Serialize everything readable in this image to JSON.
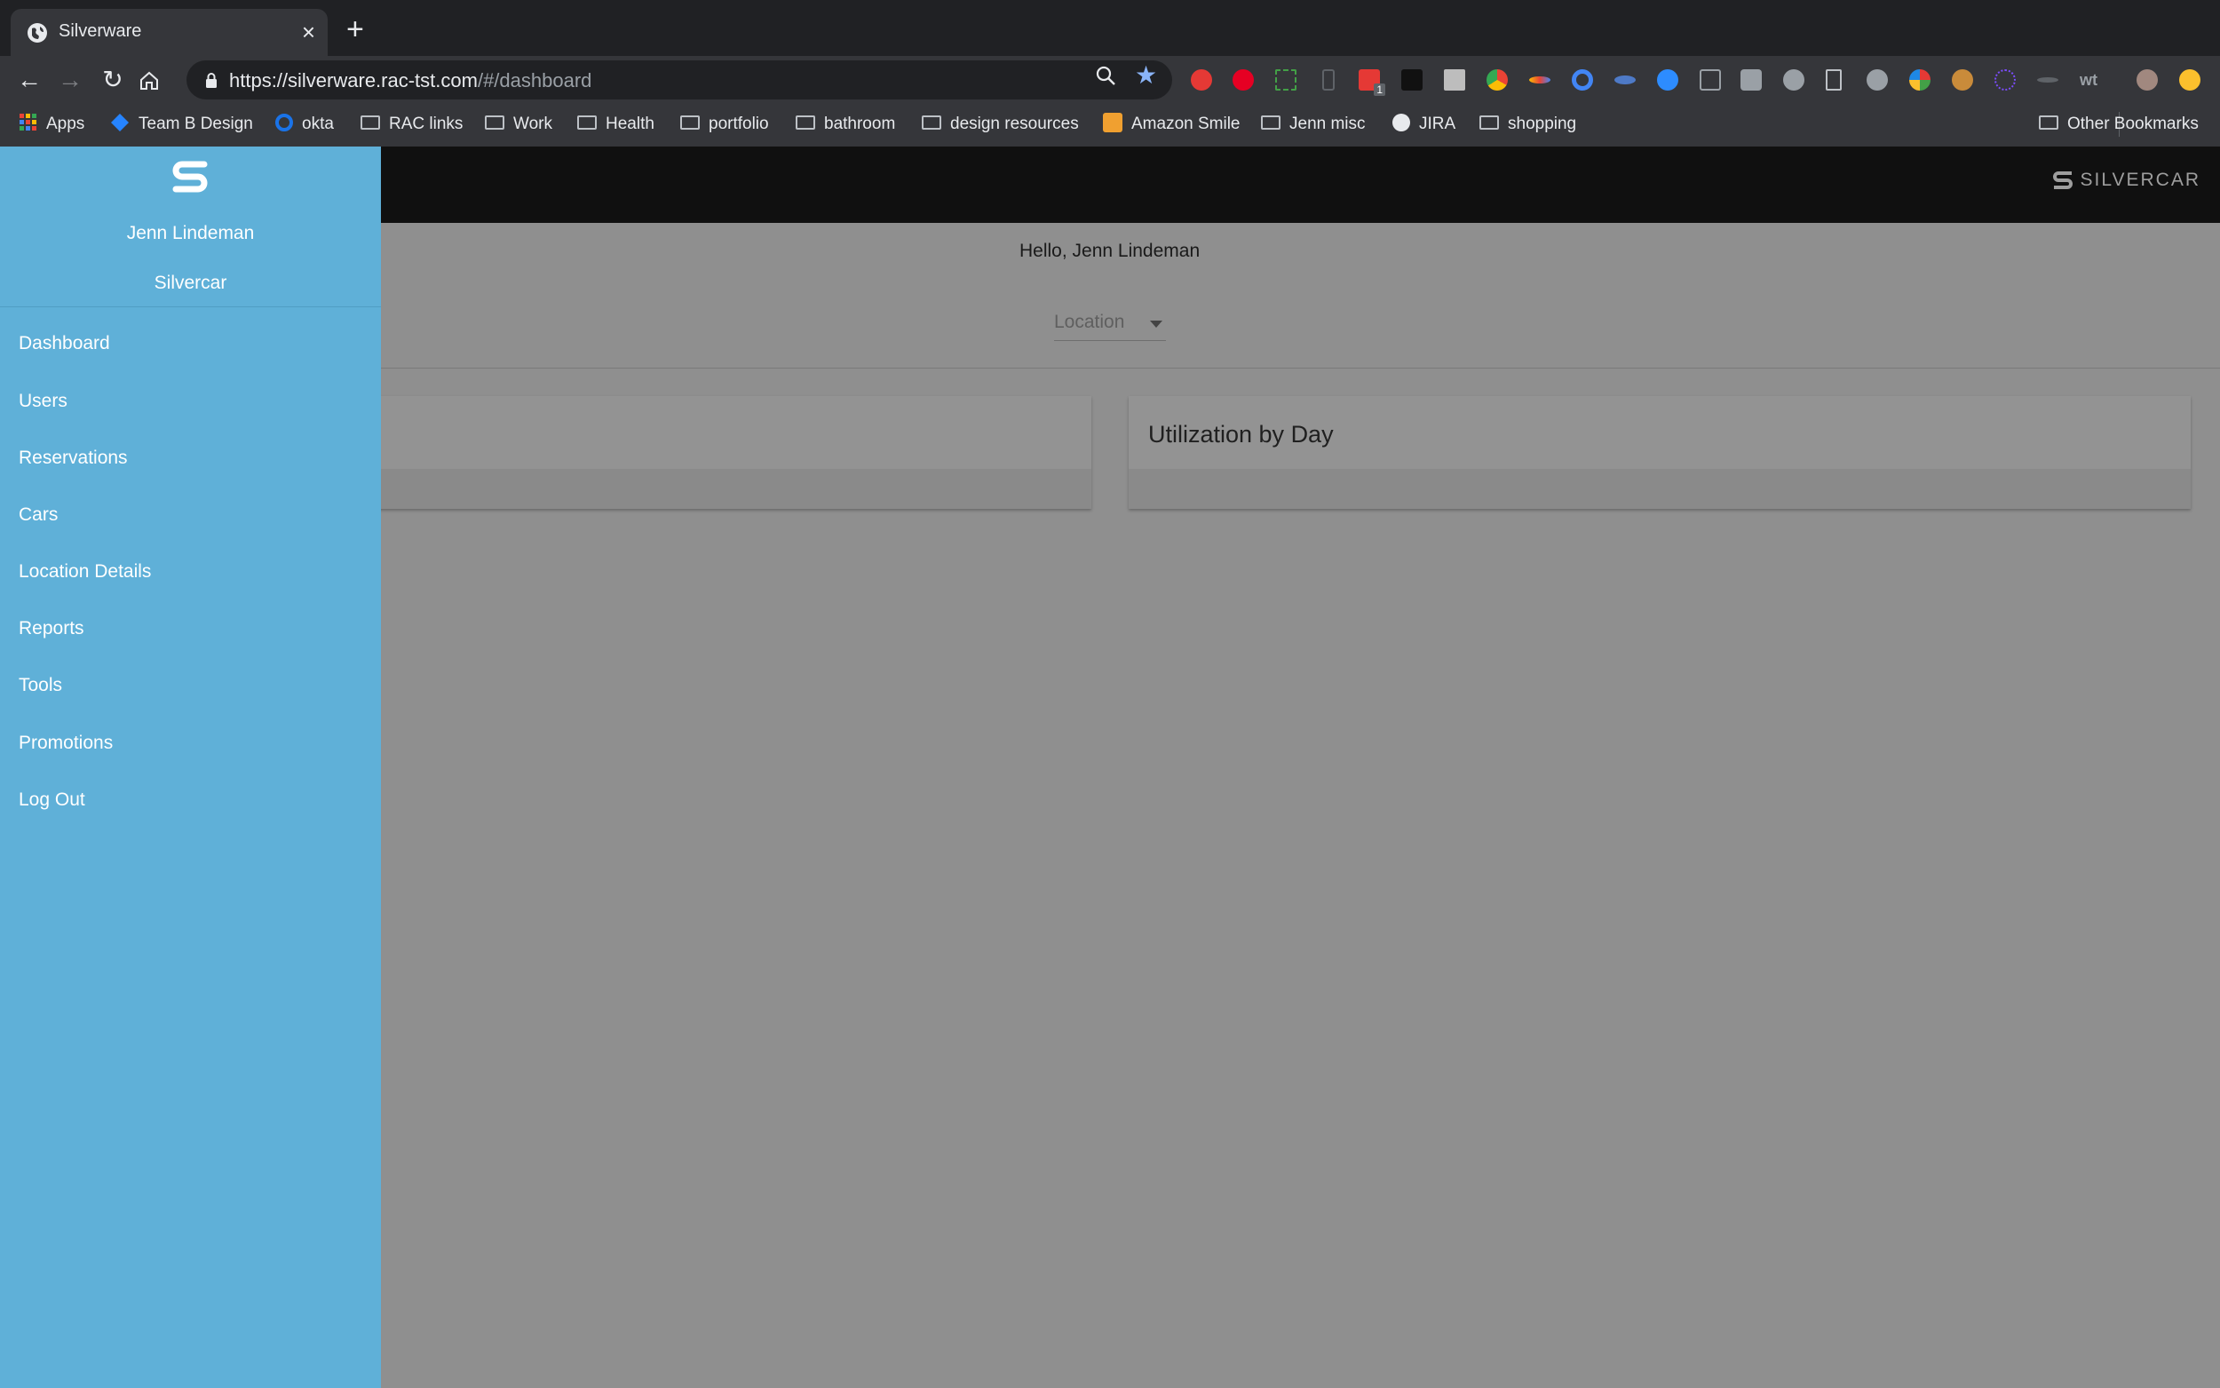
{
  "browser": {
    "tab_title": "Silverware",
    "url_host": "https://silverware.rac-tst.com",
    "url_path": "/#/dashboard",
    "bookmarks": [
      {
        "label": "Apps",
        "icon": "apps-grid-icon"
      },
      {
        "label": "Team B Design",
        "icon": "diamond-icon"
      },
      {
        "label": "okta",
        "icon": "okta-icon"
      },
      {
        "label": "RAC links",
        "icon": "folder-icon"
      },
      {
        "label": "Work",
        "icon": "folder-icon"
      },
      {
        "label": "Health",
        "icon": "folder-icon"
      },
      {
        "label": "portfolio",
        "icon": "folder-icon"
      },
      {
        "label": "bathroom",
        "icon": "folder-icon"
      },
      {
        "label": "design resources",
        "icon": "folder-icon"
      },
      {
        "label": "Amazon Smile",
        "icon": "amazon-icon"
      },
      {
        "label": "Jenn misc",
        "icon": "folder-icon"
      },
      {
        "label": "JIRA",
        "icon": "globe-icon"
      },
      {
        "label": "shopping",
        "icon": "folder-icon"
      }
    ],
    "other_bookmarks": "Other Bookmarks",
    "extension_badge": "1"
  },
  "app": {
    "brand": "SILVERCAR",
    "greeting": "Hello, Jenn Lindeman",
    "location_placeholder": "Location",
    "cards": [
      {
        "title": ""
      },
      {
        "title": "Utilization by Day"
      }
    ]
  },
  "sidebar": {
    "user_name": "Jenn Lindeman",
    "org": "Silvercar",
    "items": [
      {
        "label": "Dashboard"
      },
      {
        "label": "Users"
      },
      {
        "label": "Reservations"
      },
      {
        "label": "Cars"
      },
      {
        "label": "Location Details"
      },
      {
        "label": "Reports"
      },
      {
        "label": "Tools"
      },
      {
        "label": "Promotions"
      },
      {
        "label": "Log Out"
      }
    ]
  },
  "colors": {
    "sidebar": "#5fb0d8",
    "appbar": "#101010",
    "overlay": "#8f8f8f",
    "chrome": "#35363a"
  }
}
